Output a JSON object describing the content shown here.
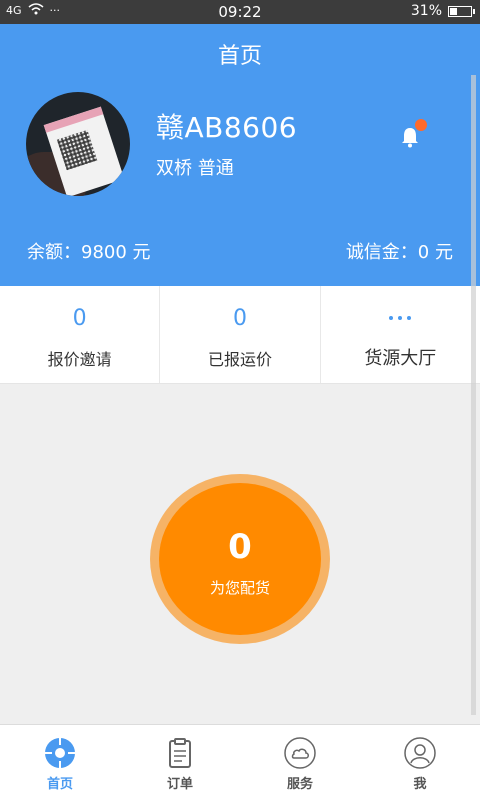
{
  "status": {
    "signal_text": "4G",
    "time": "09:22",
    "battery": "31%",
    "battery_level": 0.31
  },
  "header": {
    "title": "首页",
    "plate": "赣AB8606",
    "subinfo": "双桥 普通",
    "balance": "余额：9800 元",
    "deposit": "诚信金：0 元"
  },
  "stats": [
    {
      "value": "0",
      "label": "报价邀请"
    },
    {
      "value": "0",
      "label": "已报运价"
    },
    {
      "value": "",
      "label": "货源大厅"
    }
  ],
  "match": {
    "count": "0",
    "label": "为您配货"
  },
  "tabs": [
    {
      "label": "首页",
      "icon": "home-icon"
    },
    {
      "label": "订单",
      "icon": "clipboard-icon"
    },
    {
      "label": "服务",
      "icon": "cloud-icon"
    },
    {
      "label": "我",
      "icon": "user-icon"
    }
  ],
  "colors": {
    "primary": "#4a9af0",
    "accent": "#ff8a00",
    "badge": "#ff6a2b"
  }
}
